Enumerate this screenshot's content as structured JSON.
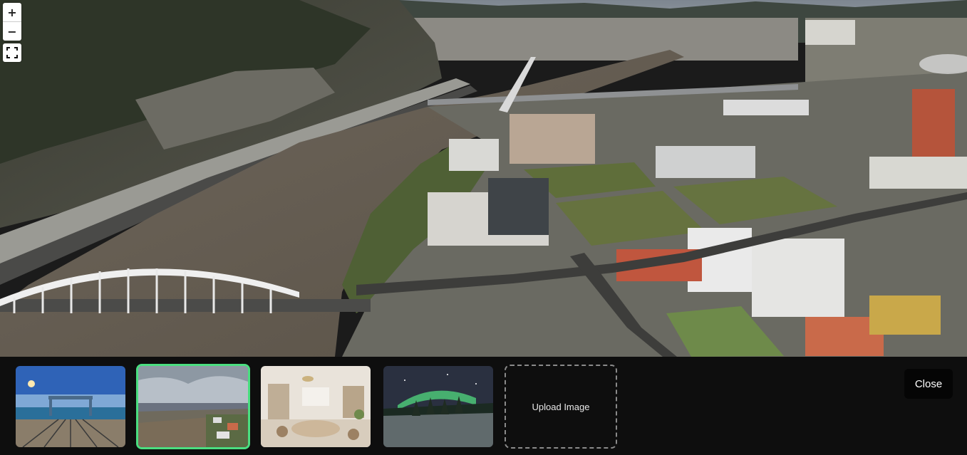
{
  "controls": {
    "zoom_in_label": "+",
    "zoom_out_label": "−",
    "fullscreen_icon": "fullscreen-icon"
  },
  "gallery": {
    "thumbnails": [
      {
        "name": "pier-panorama",
        "selected": false
      },
      {
        "name": "river-town-aerial",
        "selected": true
      },
      {
        "name": "interior-room",
        "selected": false
      },
      {
        "name": "aurora-snow",
        "selected": false
      }
    ],
    "selected_accent": "#4ade80",
    "upload_label": "Upload Image",
    "close_label": "Close"
  }
}
